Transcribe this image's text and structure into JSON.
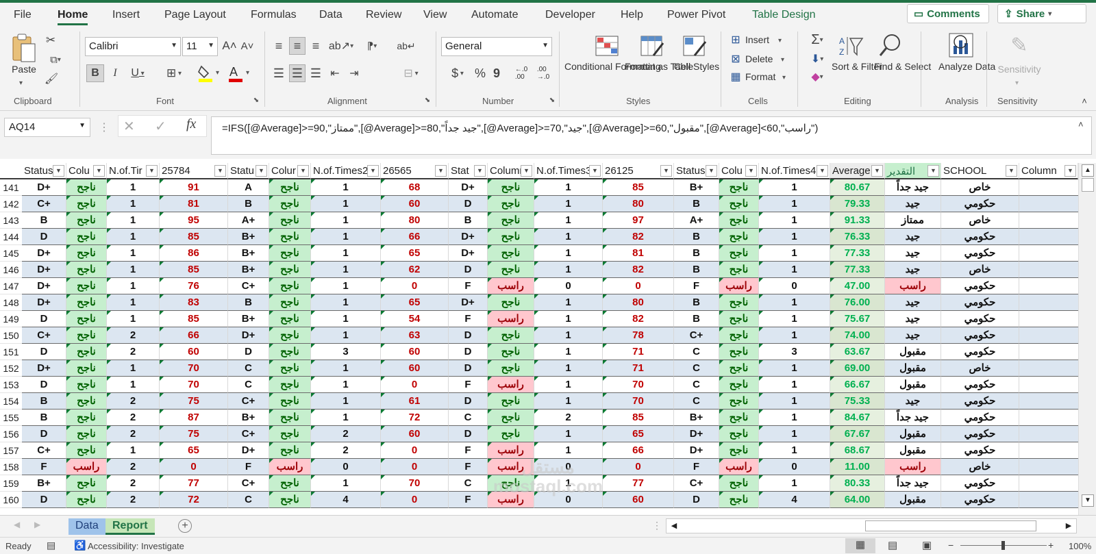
{
  "ribbon_tabs": [
    "File",
    "Home",
    "Insert",
    "Page Layout",
    "Formulas",
    "Data",
    "Review",
    "View",
    "Automate",
    "Developer",
    "Help",
    "Power Pivot",
    "Table Design"
  ],
  "comments_label": "Comments",
  "share_label": "Share",
  "clipboard": {
    "paste": "Paste",
    "group": "Clipboard"
  },
  "font": {
    "name": "Calibri",
    "size": "11",
    "group": "Font"
  },
  "alignment": {
    "group": "Alignment"
  },
  "number": {
    "format": "General",
    "group": "Number",
    "currency": "$",
    "percent": "%",
    "comma": "9",
    "inc_decimal": "←.0\n.00",
    "dec_decimal": ".00\n→.0"
  },
  "styles": {
    "conditional": "Conditional Formatting",
    "format_table": "Format as Table",
    "cell_styles": "Cell Styles",
    "group": "Styles"
  },
  "cells": {
    "insert": "Insert",
    "delete": "Delete",
    "format": "Format",
    "group": "Cells"
  },
  "editing": {
    "sort": "Sort & Filter",
    "find": "Find & Select",
    "group": "Editing"
  },
  "analysis": {
    "analyze": "Analyze Data",
    "group": "Analysis"
  },
  "sensitivity": {
    "label": "Sensitivity",
    "group": "Sensitivity"
  },
  "name_box": "AQ14",
  "formula": "=IFS([@Average]>=90,\"ممتاز\",[@Average]>=80,\"جيد جداً\",[@Average]>=70,\"جيد\",[@Average]>=60,\"مقبول\",[@Average]<60,\"راسب\")",
  "headers": [
    "Status",
    "Colu",
    "N.of.Tir",
    "25784",
    "Statu",
    "Colur",
    "N.of.Times2",
    "26565",
    "Stat",
    "Column",
    "N.of.Times3",
    "26125",
    "Status",
    "Colu",
    "N.of.Times4",
    "Average",
    "التقدير",
    "SCHOOL",
    "Column"
  ],
  "rows": [
    {
      "n": "141",
      "c": [
        "D+",
        "ناجح",
        "1",
        "91",
        "A",
        "ناجح",
        "1",
        "68",
        "D+",
        "ناجح",
        "1",
        "85",
        "B+",
        "ناجح",
        "1",
        "80.67",
        "جيد جداً",
        "خاص",
        ""
      ]
    },
    {
      "n": "142",
      "c": [
        "C+",
        "ناجح",
        "1",
        "81",
        "B",
        "ناجح",
        "1",
        "60",
        "D",
        "ناجح",
        "1",
        "80",
        "B",
        "ناجح",
        "1",
        "79.33",
        "جيد",
        "حكومي",
        ""
      ]
    },
    {
      "n": "143",
      "c": [
        "B",
        "ناجح",
        "1",
        "95",
        "A+",
        "ناجح",
        "1",
        "80",
        "B",
        "ناجح",
        "1",
        "97",
        "A+",
        "ناجح",
        "1",
        "91.33",
        "ممتاز",
        "خاص",
        ""
      ]
    },
    {
      "n": "144",
      "c": [
        "D",
        "ناجح",
        "1",
        "85",
        "B+",
        "ناجح",
        "1",
        "66",
        "D+",
        "ناجح",
        "1",
        "82",
        "B",
        "ناجح",
        "1",
        "76.33",
        "جيد",
        "حكومي",
        ""
      ]
    },
    {
      "n": "145",
      "c": [
        "D+",
        "ناجح",
        "1",
        "86",
        "B+",
        "ناجح",
        "1",
        "65",
        "D+",
        "ناجح",
        "1",
        "81",
        "B",
        "ناجح",
        "1",
        "77.33",
        "جيد",
        "حكومي",
        ""
      ]
    },
    {
      "n": "146",
      "c": [
        "D+",
        "ناجح",
        "1",
        "85",
        "B+",
        "ناجح",
        "1",
        "62",
        "D",
        "ناجح",
        "1",
        "82",
        "B",
        "ناجح",
        "1",
        "77.33",
        "جيد",
        "خاص",
        ""
      ]
    },
    {
      "n": "147",
      "c": [
        "D+",
        "ناجح",
        "1",
        "76",
        "C+",
        "ناجح",
        "1",
        "0",
        "F",
        "راسب",
        "0",
        "0",
        "F",
        "راسب",
        "0",
        "47.00",
        "راسب",
        "حكومي",
        ""
      ]
    },
    {
      "n": "148",
      "c": [
        "D+",
        "ناجح",
        "1",
        "83",
        "B",
        "ناجح",
        "1",
        "65",
        "D+",
        "ناجح",
        "1",
        "80",
        "B",
        "ناجح",
        "1",
        "76.00",
        "جيد",
        "حكومي",
        ""
      ]
    },
    {
      "n": "149",
      "c": [
        "D",
        "ناجح",
        "1",
        "85",
        "B+",
        "ناجح",
        "1",
        "54",
        "F",
        "راسب",
        "1",
        "82",
        "B",
        "ناجح",
        "1",
        "75.67",
        "جيد",
        "حكومي",
        ""
      ]
    },
    {
      "n": "150",
      "c": [
        "C+",
        "ناجح",
        "2",
        "66",
        "D+",
        "ناجح",
        "1",
        "63",
        "D",
        "ناجح",
        "1",
        "78",
        "C+",
        "ناجح",
        "1",
        "74.00",
        "جيد",
        "حكومي",
        ""
      ]
    },
    {
      "n": "151",
      "c": [
        "D",
        "ناجح",
        "2",
        "60",
        "D",
        "ناجح",
        "3",
        "60",
        "D",
        "ناجح",
        "1",
        "71",
        "C",
        "ناجح",
        "3",
        "63.67",
        "مقبول",
        "حكومي",
        ""
      ]
    },
    {
      "n": "152",
      "c": [
        "D+",
        "ناجح",
        "1",
        "70",
        "C",
        "ناجح",
        "1",
        "60",
        "D",
        "ناجح",
        "1",
        "71",
        "C",
        "ناجح",
        "1",
        "69.00",
        "مقبول",
        "خاص",
        ""
      ]
    },
    {
      "n": "153",
      "c": [
        "D",
        "ناجح",
        "1",
        "70",
        "C",
        "ناجح",
        "1",
        "0",
        "F",
        "راسب",
        "1",
        "70",
        "C",
        "ناجح",
        "1",
        "66.67",
        "مقبول",
        "حكومي",
        ""
      ]
    },
    {
      "n": "154",
      "c": [
        "B",
        "ناجح",
        "2",
        "75",
        "C+",
        "ناجح",
        "1",
        "61",
        "D",
        "ناجح",
        "1",
        "70",
        "C",
        "ناجح",
        "1",
        "75.33",
        "جيد",
        "حكومي",
        ""
      ]
    },
    {
      "n": "155",
      "c": [
        "B",
        "ناجح",
        "2",
        "87",
        "B+",
        "ناجح",
        "1",
        "72",
        "C",
        "ناجح",
        "2",
        "85",
        "B+",
        "ناجح",
        "1",
        "84.67",
        "جيد جداً",
        "حكومي",
        ""
      ]
    },
    {
      "n": "156",
      "c": [
        "D",
        "ناجح",
        "2",
        "75",
        "C+",
        "ناجح",
        "2",
        "60",
        "D",
        "ناجح",
        "1",
        "65",
        "D+",
        "ناجح",
        "1",
        "67.67",
        "مقبول",
        "حكومي",
        ""
      ]
    },
    {
      "n": "157",
      "c": [
        "C+",
        "ناجح",
        "1",
        "65",
        "D+",
        "ناجح",
        "2",
        "0",
        "F",
        "راسب",
        "1",
        "66",
        "D+",
        "ناجح",
        "1",
        "68.67",
        "مقبول",
        "حكومي",
        ""
      ]
    },
    {
      "n": "158",
      "c": [
        "F",
        "راسب",
        "2",
        "0",
        "F",
        "راسب",
        "0",
        "0",
        "F",
        "راسب",
        "0",
        "0",
        "F",
        "راسب",
        "0",
        "11.00",
        "راسب",
        "خاص",
        ""
      ]
    },
    {
      "n": "159",
      "c": [
        "B+",
        "ناجح",
        "2",
        "77",
        "C+",
        "ناجح",
        "1",
        "70",
        "C",
        "ناجح",
        "1",
        "77",
        "C+",
        "ناجح",
        "1",
        "80.33",
        "جيد جداً",
        "حكومي",
        ""
      ]
    },
    {
      "n": "160",
      "c": [
        "D",
        "ناجح",
        "2",
        "72",
        "C",
        "ناجح",
        "4",
        "0",
        "F",
        "راسب",
        "0",
        "60",
        "D",
        "ناجح",
        "4",
        "64.00",
        "مقبول",
        "حكومي",
        ""
      ]
    }
  ],
  "sheets": [
    "Data",
    "Report"
  ],
  "status": {
    "ready": "Ready",
    "accessibility": "Accessibility: Investigate",
    "zoom": "100%"
  },
  "watermark": "مستقل\nmostaql.com",
  "colors": {
    "accent": "#217346",
    "pass_bg": "#c6efce",
    "pass_fg": "#006100",
    "fail_bg": "#ffc7ce",
    "fail_fg": "#9c0006",
    "score_red": "#c00000",
    "avg_green": "#00b050",
    "band": "#dce6f1"
  }
}
